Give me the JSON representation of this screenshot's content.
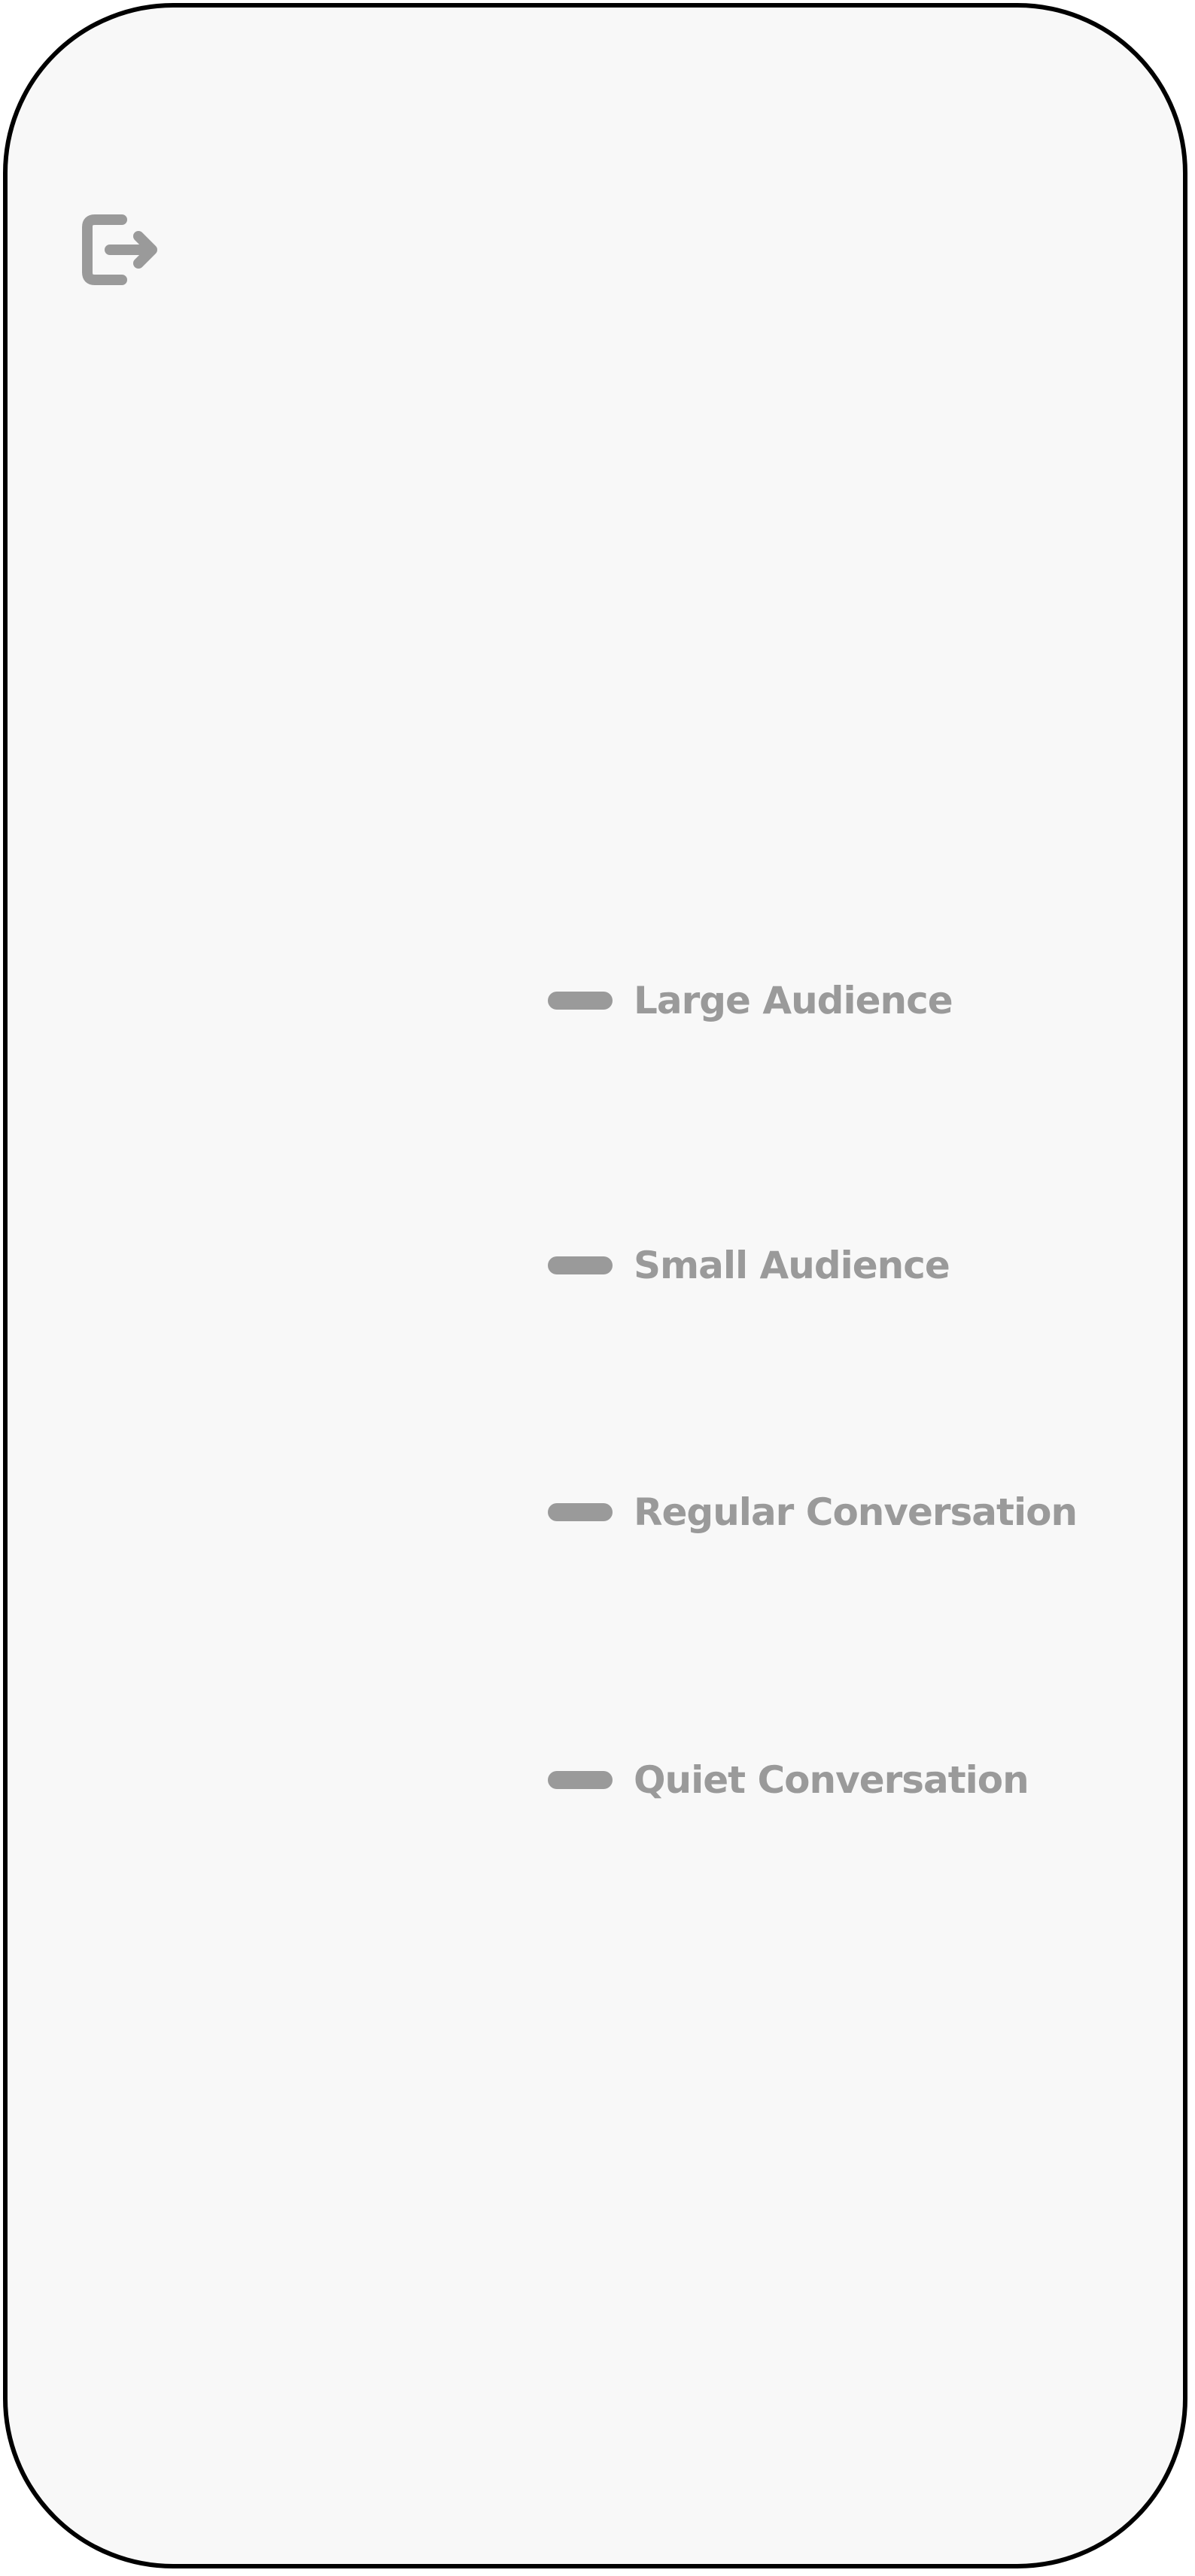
{
  "header": {
    "exit_icon": "exit-arrow-icon"
  },
  "levels": {
    "items": [
      {
        "label": "Large Audience"
      },
      {
        "label": "Small Audience"
      },
      {
        "label": "Regular Conversation"
      },
      {
        "label": "Quiet Conversation"
      }
    ]
  },
  "colors": {
    "background": "#f8f8f8",
    "frame": "#000000",
    "muted_gray": "#9a9a9a"
  }
}
